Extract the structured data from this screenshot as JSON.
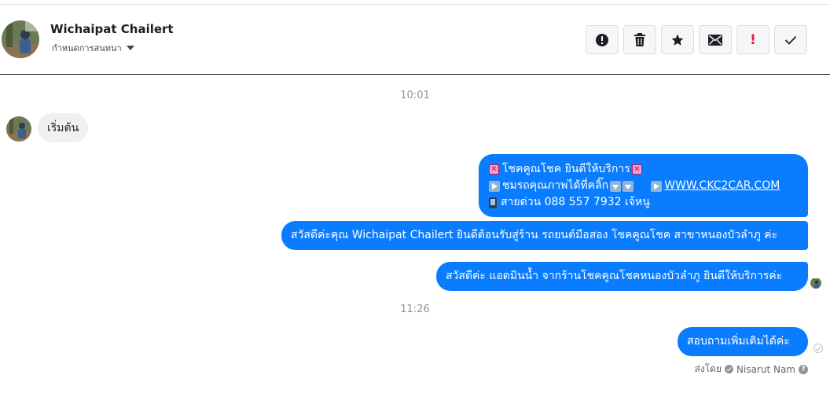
{
  "header": {
    "name": "Wichaipat Chailert",
    "subtitle": "กำหนดการสนทนา"
  },
  "toolbar": {
    "buttons": [
      {
        "icon": "alert-circle-icon"
      },
      {
        "icon": "trash-icon"
      },
      {
        "icon": "star-icon"
      },
      {
        "icon": "envelope-icon"
      },
      {
        "icon": "exclamation-icon",
        "label": "!"
      },
      {
        "icon": "checkmark-icon"
      }
    ]
  },
  "thread": {
    "time1": "10:01",
    "incoming": "เริ่มต้น",
    "msg1": {
      "line1": "โชคคูณโชค ยินดีให้บริการ",
      "line2a": "ชมรถคุณภาพได้ที่คลิ๊ก",
      "link": "WWW.CKC2CAR.COM",
      "line3": "สายด่วน 088 557 7932 เจ้หนู"
    },
    "msg2": "สวัสดีค่ะคุณ Wichaipat Chailert ยินดีต้อนรับสู่ร้าน รถยนต์มือสอง โชคคูณโชค สาขาหนองบัวลำภู ค่ะ",
    "msg3": "สวัสดีค่ะ แอดมินน้ำ จากร้านโชคคูณโชคหนองบัวลำภู ยินดีให้บริการค่ะ",
    "time2": "11:26",
    "msg4": "สอบถามเพิ่มเติมได้ค่ะ",
    "sent_by_label": "ส่งโดย",
    "sent_by_name": "Nisarut Nam"
  },
  "colors": {
    "outgoing_bubble": "#0a7cff",
    "incoming_bubble": "#f0f0f0"
  }
}
